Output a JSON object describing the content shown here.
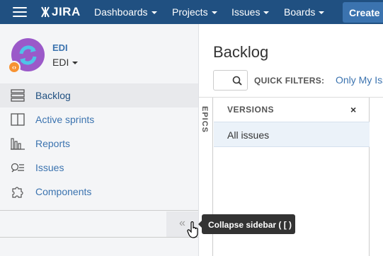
{
  "topnav": {
    "logo_text": "JIRA",
    "items": [
      {
        "label": "Dashboards"
      },
      {
        "label": "Projects"
      },
      {
        "label": "Issues"
      },
      {
        "label": "Boards"
      }
    ],
    "create_label": "Create"
  },
  "sidebar": {
    "project_name": "EDI",
    "project_type": "EDI",
    "badge_icon": "code-icon",
    "items": [
      {
        "label": "Backlog",
        "icon": "backlog-icon",
        "active": true
      },
      {
        "label": "Active sprints",
        "icon": "board-icon",
        "active": false
      },
      {
        "label": "Reports",
        "icon": "reports-icon",
        "active": false
      },
      {
        "label": "Issues",
        "icon": "issues-icon",
        "active": false
      },
      {
        "label": "Components",
        "icon": "puzzle-icon",
        "active": false
      }
    ],
    "collapse_glyph": "«",
    "tooltip": "Collapse sidebar ( [ )"
  },
  "main": {
    "title": "Backlog",
    "quick_filters_label": "QUICK FILTERS:",
    "quick_filter_link": "Only My Issues",
    "epics_label": "EPICS",
    "versions_title": "VERSIONS",
    "versions_close": "×",
    "all_issues": "All issues"
  },
  "colors": {
    "nav_bg": "#205081",
    "create_bg": "#3b73af",
    "link": "#3b73af",
    "sidebar_bg": "#f4f5f7",
    "avatar": "#9b59c9",
    "badge": "#f79232",
    "tooltip_bg": "#333333"
  }
}
